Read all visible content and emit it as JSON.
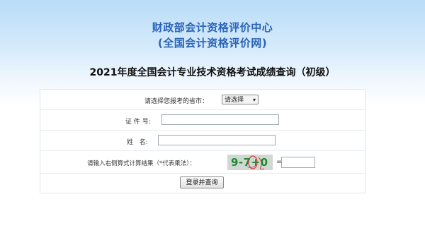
{
  "header": {
    "org_name": "财政部会计资格评价中心",
    "org_site": "(全国会计资格评价网)"
  },
  "page_title": "2021年度全国会计专业技术资格考试成绩查询（初级）",
  "form": {
    "province_label": "请选择您报考的省市：",
    "province_selected": "请选择",
    "id_label": "证 件 号:",
    "id_value": "",
    "name_label": "姓   名:",
    "name_value": "",
    "captcha_label": "请输入右侧算式计算结果（*代表乘法）：",
    "captcha_text": "9-7+0",
    "equals_sign": "=",
    "captcha_answer": "",
    "submit_label": "登录并查询"
  },
  "colors": {
    "title_blue": "#2a63b8",
    "captcha_green": "#1c8a2e",
    "captcha_red_scribble": "#d83a3a"
  }
}
